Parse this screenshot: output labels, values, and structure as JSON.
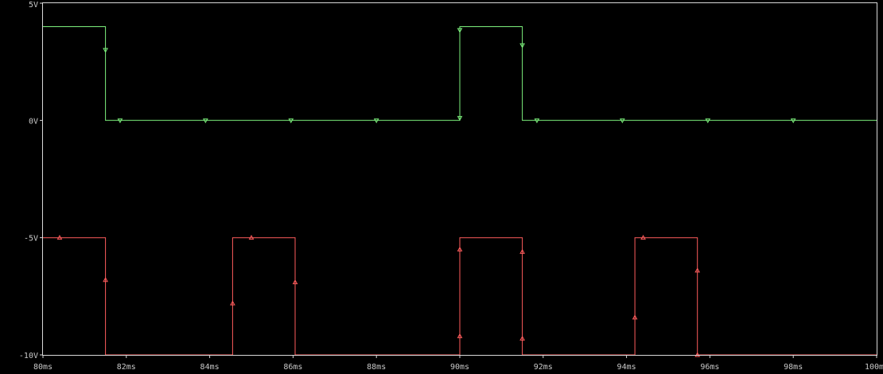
{
  "chart_data": {
    "type": "line",
    "title": "",
    "xlabel": "",
    "ylabel": "",
    "x_unit_suffix": "ms",
    "xlim": [
      80,
      100
    ],
    "ylim": [
      -10,
      5
    ],
    "x_ticks": [
      80,
      82,
      84,
      86,
      88,
      90,
      92,
      94,
      96,
      98,
      100
    ],
    "x_tick_labels": [
      "80ms",
      "82ms",
      "84ms",
      "86ms",
      "88ms",
      "90ms",
      "92ms",
      "94ms",
      "96ms",
      "98ms",
      "100ms"
    ],
    "y_ticks": [
      5,
      0,
      -5,
      -10
    ],
    "y_tick_labels": [
      "5V",
      "0V",
      "-5V",
      "-10V"
    ],
    "grid": false,
    "background": "#000000",
    "series": [
      {
        "color": "#7cf07c",
        "marker": "triangle-down",
        "points": [
          [
            80,
            4
          ],
          [
            81.5,
            4
          ],
          [
            81.5,
            0
          ],
          [
            90,
            0
          ],
          [
            90,
            4
          ],
          [
            91.5,
            4
          ],
          [
            91.5,
            0
          ],
          [
            100,
            0
          ]
        ],
        "markers": [
          [
            81.5,
            3
          ],
          [
            81.85,
            0
          ],
          [
            83.9,
            0
          ],
          [
            85.95,
            0
          ],
          [
            88,
            0
          ],
          [
            90,
            0.1
          ],
          [
            90,
            3.85
          ],
          [
            91.5,
            3.2
          ],
          [
            91.85,
            0
          ],
          [
            93.9,
            0
          ],
          [
            95.95,
            0
          ],
          [
            98,
            0
          ]
        ]
      },
      {
        "color": "#ff5c5c",
        "marker": "triangle-up",
        "points": [
          [
            80,
            -5
          ],
          [
            81.5,
            -5
          ],
          [
            81.5,
            -10
          ],
          [
            84.55,
            -10
          ],
          [
            84.55,
            -5
          ],
          [
            86.05,
            -5
          ],
          [
            86.05,
            -10
          ],
          [
            90,
            -10
          ],
          [
            90,
            -5
          ],
          [
            91.5,
            -5
          ],
          [
            91.5,
            -10
          ],
          [
            94.2,
            -10
          ],
          [
            94.2,
            -5
          ],
          [
            95.7,
            -5
          ],
          [
            95.7,
            -10
          ],
          [
            100,
            -10
          ]
        ],
        "markers": [
          [
            80.4,
            -5
          ],
          [
            81.5,
            -6.8
          ],
          [
            84.55,
            -7.8
          ],
          [
            85,
            -5
          ],
          [
            86.05,
            -6.9
          ],
          [
            90,
            -5.5
          ],
          [
            90,
            -9.2
          ],
          [
            91.5,
            -5.6
          ],
          [
            91.5,
            -9.3
          ],
          [
            94.2,
            -8.4
          ],
          [
            94.4,
            -5
          ],
          [
            95.7,
            -6.4
          ],
          [
            95.7,
            -10
          ]
        ]
      }
    ]
  }
}
